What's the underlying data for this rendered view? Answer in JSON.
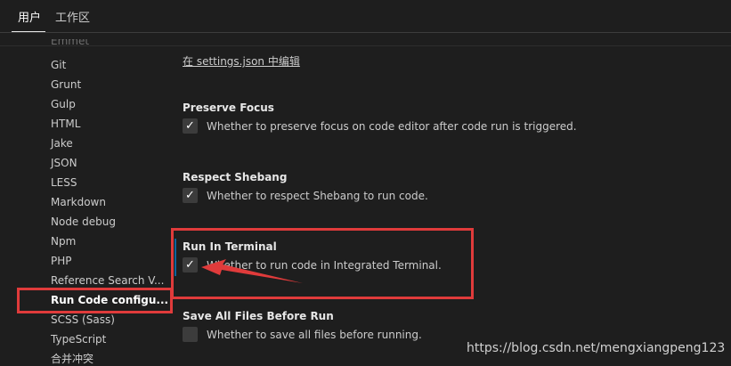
{
  "tabs": [
    {
      "label": "用户",
      "active": true
    },
    {
      "label": "工作区",
      "active": false
    }
  ],
  "sidebar": {
    "items": [
      "Emmet",
      "Git",
      "Grunt",
      "Gulp",
      "HTML",
      "Jake",
      "JSON",
      "LESS",
      "Markdown",
      "Node debug",
      "Npm",
      "PHP",
      "Reference Search V...",
      "Run Code configu...",
      "SCSS (Sass)",
      "TypeScript",
      "合并冲突"
    ],
    "selected_index": 13
  },
  "main": {
    "edit_link": "在 settings.json 中编辑",
    "settings": [
      {
        "title": "Preserve Focus",
        "desc": "Whether to preserve focus on code editor after code run is triggered.",
        "checked": true
      },
      {
        "title": "Respect Shebang",
        "desc": "Whether to respect Shebang to run code.",
        "checked": true
      },
      {
        "title": "Run In Terminal",
        "desc": "Whether to run code in Integrated Terminal.",
        "checked": true
      },
      {
        "title": "Save All Files Before Run",
        "desc": "Whether to save all files before running.",
        "checked": false
      }
    ]
  },
  "watermark": "https://blog.csdn.net/mengxiangpeng123",
  "colors": {
    "background": "#1e1e1e",
    "annotation_red": "#e03b3b",
    "modified_indicator": "#0e639c"
  }
}
